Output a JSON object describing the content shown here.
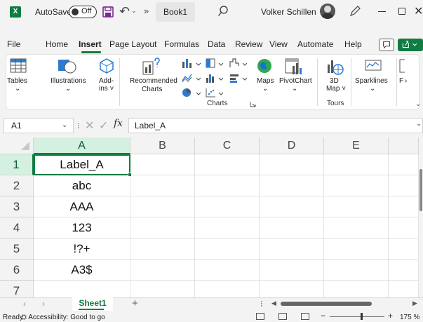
{
  "app": {
    "logo_letter": "X",
    "autosave_label": "AutoSave",
    "autosave_state": "Off",
    "document": "Book1",
    "user": "Volker Schillen",
    "accent": "#107c41"
  },
  "menu": {
    "tabs": [
      "File",
      "Home",
      "Insert",
      "Page Layout",
      "Formulas",
      "Data",
      "Review",
      "View",
      "Automate",
      "Help"
    ],
    "active": "Insert"
  },
  "ribbon": {
    "tables": "Tables",
    "illustrations": "Illustrations",
    "addins": [
      "Add-",
      "ins ˅"
    ],
    "recommended_charts": [
      "Recommended",
      "Charts"
    ],
    "maps": "Maps",
    "pivotchart": "PivotChart",
    "map3d": [
      "3D",
      "Map ˅"
    ],
    "sparklines": "Sparklines",
    "filters_partial": "F",
    "charts_group": "Charts",
    "tours_group": "Tours"
  },
  "formula_bar": {
    "name_box": "A1",
    "fx": "fx",
    "content": "Label_A"
  },
  "grid": {
    "columns": [
      "A",
      "B",
      "C",
      "D",
      "E"
    ],
    "rows": [
      "1",
      "2",
      "3",
      "4",
      "5",
      "6",
      "7"
    ],
    "column_a": [
      "Label_A",
      "abc",
      "AAA",
      "123",
      "!?+",
      "A3$",
      ""
    ]
  },
  "sheets": {
    "tabs": [
      "Sheet1"
    ],
    "add": "+"
  },
  "status": {
    "ready": "Ready",
    "accessibility": "Accessibility: Good to go",
    "zoom": "175 %",
    "zoom_fraction": 0.58
  }
}
